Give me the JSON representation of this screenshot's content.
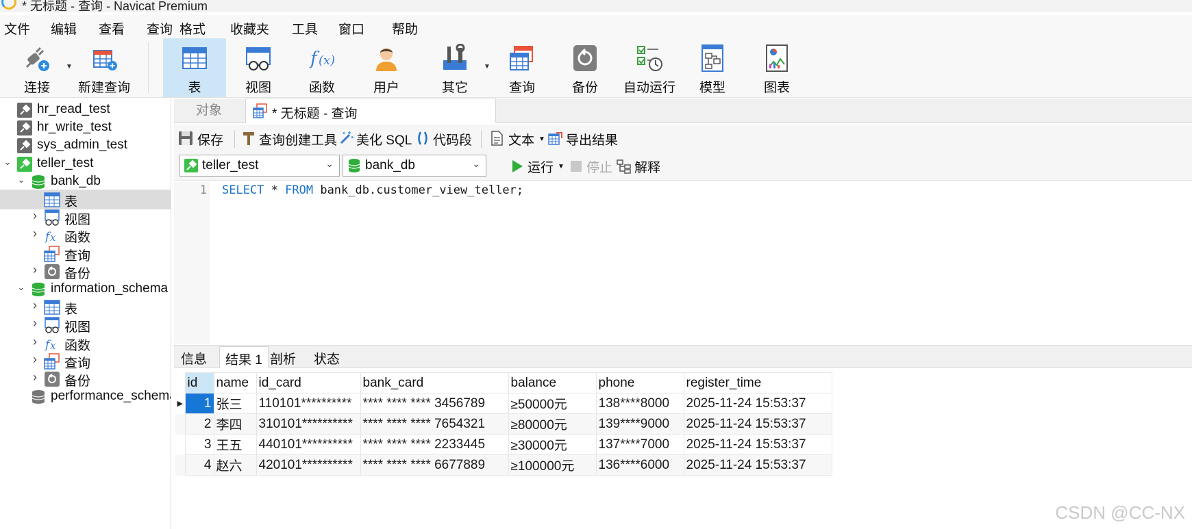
{
  "window": {
    "title": "* 无标题 - 查询 - Navicat Premium"
  },
  "menu": [
    "文件",
    "编辑",
    "查看",
    "查询",
    "格式",
    "收藏夹",
    "工具",
    "窗口",
    "帮助"
  ],
  "toolbar": {
    "connect": "连接",
    "new_query": "新建查询",
    "table": "表",
    "view": "视图",
    "function": "函数",
    "user": "用户",
    "others": "其它",
    "query": "查询",
    "backup": "备份",
    "automation": "自动运行",
    "model": "模型",
    "chart": "图表"
  },
  "sidebar": {
    "items": [
      {
        "label": "hr_read_test",
        "icon": "connection-icon"
      },
      {
        "label": "hr_write_test",
        "icon": "connection-icon"
      },
      {
        "label": "sys_admin_test",
        "icon": "connection-icon"
      },
      {
        "label": "teller_test",
        "icon": "connection-active-icon"
      },
      {
        "label": "bank_db",
        "icon": "database-icon"
      },
      {
        "label": "表",
        "icon": "table-icon"
      },
      {
        "label": "视图",
        "icon": "view-icon"
      },
      {
        "label": "函数",
        "icon": "function-icon"
      },
      {
        "label": "查询",
        "icon": "query-icon"
      },
      {
        "label": "备份",
        "icon": "backup-icon"
      },
      {
        "label": "information_schema",
        "icon": "database-icon"
      },
      {
        "label": "表",
        "icon": "table-icon"
      },
      {
        "label": "视图",
        "icon": "view-icon"
      },
      {
        "label": "函数",
        "icon": "function-icon"
      },
      {
        "label": "查询",
        "icon": "query-icon"
      },
      {
        "label": "备份",
        "icon": "backup-icon"
      },
      {
        "label": "performance_schema",
        "icon": "database-gray-icon"
      }
    ]
  },
  "tabs": {
    "objects": "对象",
    "query": "* 无标题 - 查询"
  },
  "query_toolbar": {
    "save": "保存",
    "query_builder": "查询创建工具",
    "beautify": "美化 SQL",
    "snippet": "代码段",
    "text": "文本",
    "export": "导出结果"
  },
  "selectors": {
    "connection": "teller_test",
    "database": "bank_db",
    "run": "运行",
    "stop": "停止",
    "explain": "解释"
  },
  "editor": {
    "line_number": "1",
    "kw_select": "SELECT",
    "star": " * ",
    "kw_from": "FROM",
    "rest": " bank_db.customer_view_teller;"
  },
  "result_tabs": [
    "信息",
    "结果 1",
    "剖析",
    "状态"
  ],
  "grid": {
    "columns": [
      "id",
      "name",
      "id_card",
      "bank_card",
      "balance",
      "phone",
      "register_time"
    ],
    "rows": [
      [
        "1",
        "张三",
        "110101**********",
        "**** **** **** 3456789",
        "≥50000元",
        "138****8000",
        "2025-11-24 15:53:37"
      ],
      [
        "2",
        "李四",
        "310101**********",
        "**** **** **** 7654321",
        "≥80000元",
        "139****9000",
        "2025-11-24 15:53:37"
      ],
      [
        "3",
        "王五",
        "440101**********",
        "**** **** **** 2233445",
        "≥30000元",
        "137****7000",
        "2025-11-24 15:53:37"
      ],
      [
        "4",
        "赵六",
        "420101**********",
        "**** **** **** 6677889",
        "≥100000元",
        "136****6000",
        "2025-11-24 15:53:37"
      ]
    ]
  },
  "watermark": "CSDN @CC-NX",
  "colors": {
    "accent": "#1677d6",
    "selected_tab": "#cde6f7",
    "keyword": "#1a73c8"
  }
}
